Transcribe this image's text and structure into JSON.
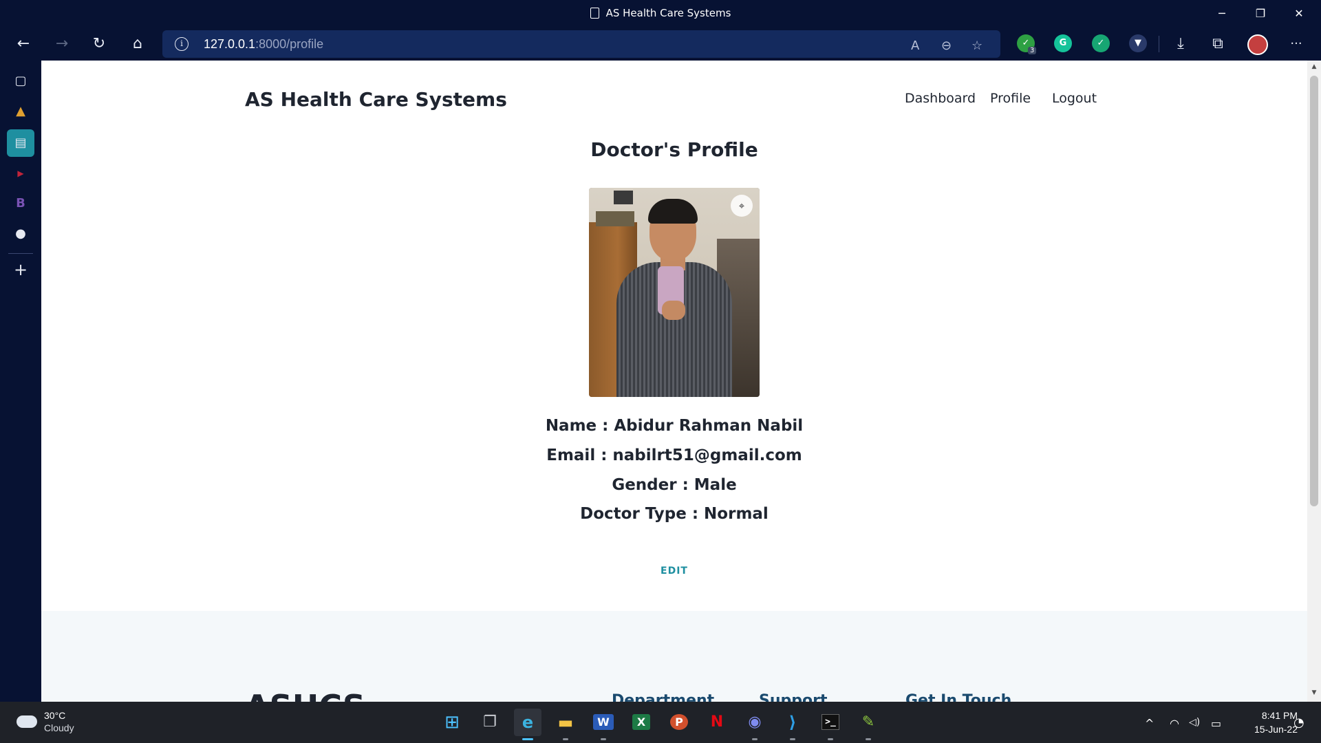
{
  "window": {
    "title": "AS Health Care Systems",
    "controls": {
      "minimize": "─",
      "restore": "❐",
      "close": "✕"
    }
  },
  "browser": {
    "url_host": "127.0.0.1",
    "url_path": ":8000/profile",
    "nav": {
      "back": "←",
      "forward": "→",
      "reload": "↻",
      "home": "⌂"
    },
    "url_icons": {
      "read_aloud": "A",
      "zoom": "⊖",
      "favorite": "☆"
    },
    "extensions": [
      {
        "name": "shield-ext",
        "glyph": "✓",
        "badge": "3",
        "color": "#2ea043"
      },
      {
        "name": "grammarly-ext",
        "glyph": "G",
        "color": "#15c39a"
      },
      {
        "name": "guard-ext",
        "glyph": "✓",
        "color": "#17a673"
      },
      {
        "name": "brave-shield-ext",
        "glyph": "▼",
        "color": "#2a3a6a"
      }
    ],
    "toolbar": {
      "download": "⤓",
      "share": "⧉",
      "more": "···"
    }
  },
  "sidebar": {
    "items": [
      {
        "name": "tabs-icon",
        "glyph": "▢"
      },
      {
        "name": "app-icon",
        "glyph": "▲"
      },
      {
        "name": "document-icon",
        "glyph": "▤",
        "active": true
      },
      {
        "name": "youtube-icon",
        "glyph": "▶"
      },
      {
        "name": "bootstrap-icon",
        "glyph": "B"
      },
      {
        "name": "github-icon",
        "glyph": "●"
      }
    ],
    "add": "+"
  },
  "page": {
    "brand": "AS Health Care Systems",
    "nav": [
      "Dashboard",
      "Profile",
      "Logout"
    ],
    "title": "Doctor's Profile",
    "name_line": "Name : Abidur Rahman Nabil",
    "email_line": "Email : nabilrt51@gmail.com",
    "gender_line": "Gender : Male",
    "type_line": "Doctor Type : Normal",
    "edit": "EDIT",
    "footer": {
      "logo": "ASHCS",
      "headings": [
        "Department",
        "Support",
        "Get In Touch"
      ]
    }
  },
  "taskbar": {
    "weather": {
      "temp": "30°C",
      "desc": "Cloudy"
    },
    "apps": [
      {
        "name": "start-icon",
        "glyph": "⊞"
      },
      {
        "name": "task-view-icon",
        "glyph": "❐"
      },
      {
        "name": "edge-icon",
        "glyph": "e",
        "active": true
      },
      {
        "name": "file-explorer-icon",
        "glyph": "▬"
      },
      {
        "name": "word-icon",
        "glyph": "W"
      },
      {
        "name": "excel-icon",
        "glyph": "X"
      },
      {
        "name": "powerpoint-icon",
        "glyph": "P"
      },
      {
        "name": "netflix-icon",
        "glyph": "N"
      },
      {
        "name": "discord-icon",
        "glyph": "◉"
      },
      {
        "name": "vscode-icon",
        "glyph": "⟩"
      },
      {
        "name": "terminal-icon",
        "glyph": ">_"
      },
      {
        "name": "notepad-icon",
        "glyph": "✎"
      }
    ],
    "tray": {
      "chevron": "^",
      "wifi": "◠",
      "volume": "◁)",
      "battery": "▭"
    },
    "time": "8:41 PM",
    "date": "15-Jun-22"
  }
}
